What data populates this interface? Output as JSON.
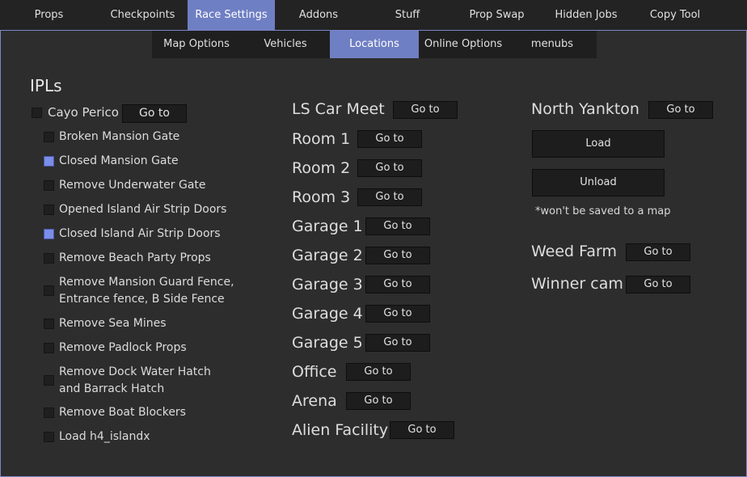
{
  "top_tabs": [
    "Props",
    "Checkpoints",
    "Race Settings",
    "Addons",
    "Stuff",
    "Prop Swap",
    "Hidden Jobs",
    "Copy Tool"
  ],
  "top_active": "Race Settings",
  "sub_tabs": [
    "Map Options",
    "Vehicles",
    "Locations",
    "Online Options",
    "menubs"
  ],
  "sub_active": "Locations",
  "ipls": {
    "heading": "IPLs",
    "cayo": {
      "label": "Cayo Perico",
      "checked": false,
      "button": "Go to"
    },
    "items": [
      {
        "label": "Broken Mansion Gate",
        "checked": false
      },
      {
        "label": "Closed Mansion Gate",
        "checked": true
      },
      {
        "label": "Remove Underwater Gate",
        "checked": false
      },
      {
        "label": "Opened Island Air Strip Doors",
        "checked": false
      },
      {
        "label": "Closed Island Air Strip Doors",
        "checked": true
      },
      {
        "label": "Remove Beach Party Props",
        "checked": false
      },
      {
        "label": "Remove Mansion Guard Fence,",
        "label2": "Entrance fence, B Side Fence",
        "checked": false
      },
      {
        "label": "Remove Sea Mines",
        "checked": false
      },
      {
        "label": "Remove Padlock Props",
        "checked": false
      },
      {
        "label": "Remove Dock Water Hatch",
        "label2": "and Barrack Hatch",
        "checked": false
      },
      {
        "label": "Remove Boat Blockers",
        "checked": false
      },
      {
        "label": "Load h4_islandx",
        "checked": false
      }
    ]
  },
  "locations": [
    {
      "name": "LS Car Meet",
      "button": "Go to"
    },
    {
      "name": "Room 1",
      "button": "Go to"
    },
    {
      "name": "Room 2",
      "button": "Go to"
    },
    {
      "name": "Room 3",
      "button": "Go to"
    },
    {
      "name": "Garage 1",
      "button": "Go to"
    },
    {
      "name": "Garage 2",
      "button": "Go to"
    },
    {
      "name": "Garage 3",
      "button": "Go to"
    },
    {
      "name": "Garage 4",
      "button": "Go to"
    },
    {
      "name": "Garage 5",
      "button": "Go to"
    },
    {
      "name": "Office",
      "button": "Go to"
    },
    {
      "name": "Arena",
      "button": "Go to"
    },
    {
      "name": "Alien Facility",
      "button": "Go to"
    }
  ],
  "north_yankton": {
    "name": "North Yankton",
    "button": "Go to",
    "load": "Load",
    "unload": "Unload",
    "note": "*won't be saved to a map"
  },
  "extras": [
    {
      "name": "Weed Farm",
      "button": "Go to"
    },
    {
      "name": "Winner cam",
      "button": "Go to"
    }
  ],
  "colors": {
    "accent": "#6f7fc3",
    "checkbox_checked": "#7b8ee8",
    "background": "#2d2d2d"
  }
}
